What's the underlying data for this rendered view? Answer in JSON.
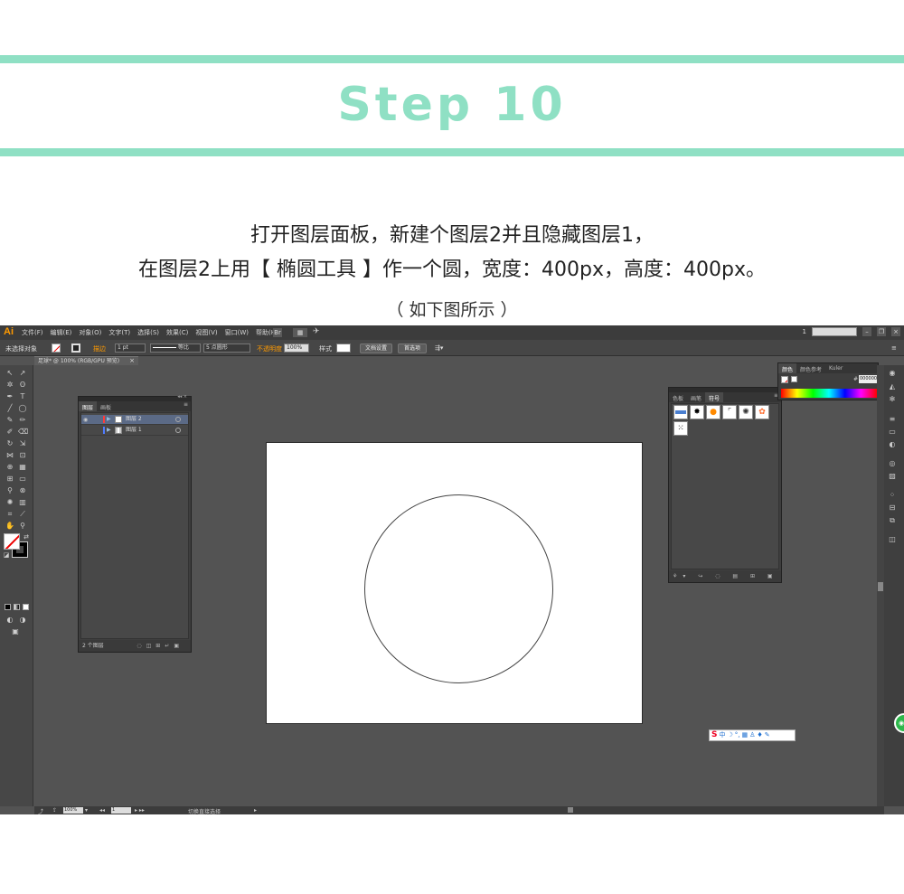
{
  "header": {
    "step_title": "Step 10",
    "line1": "打开图层面板，新建个图层2并且隐藏图层1，",
    "line2": "在图层2上用【 椭圆工具 】作一个圆，宽度：400px，高度：400px。",
    "line3": "（ 如下图所示 ）"
  },
  "app": {
    "logo": "Ai",
    "menu": [
      "文件(F)",
      "编辑(E)",
      "对象(O)",
      "文字(T)",
      "选择(S)",
      "效果(C)",
      "视图(V)",
      "窗口(W)",
      "帮助(H)"
    ],
    "workspace_number": "1"
  },
  "controlbar": {
    "no_selection": "未选择对象",
    "stroke_label": "描边",
    "stroke_weight": "1 pt",
    "uniform": "等比",
    "brush": "5 点圆形",
    "opacity_label": "不透明度",
    "opacity_value": "100%",
    "style_label": "样式",
    "doc_setup": "文档设置",
    "preferences": "首选项"
  },
  "document": {
    "tab_title": "足球* @ 100% (RGB/GPU 预览)",
    "tab_close": "×"
  },
  "layers_panel": {
    "tabs": [
      "图层",
      "画板"
    ],
    "layers": [
      {
        "name": "图层 2",
        "selected": true,
        "color": "#ff3b3b"
      },
      {
        "name": "图层 1",
        "selected": false,
        "color": "#4f7bff"
      }
    ],
    "footer": "2 个图层"
  },
  "symbols_panel": {
    "tabs": [
      "色板",
      "画笔",
      "符号"
    ]
  },
  "color_panel": {
    "tabs": [
      "颜色",
      "颜色参考",
      "Kuler"
    ],
    "hex_prefix": "#",
    "hex_value": "000000"
  },
  "statusbar": {
    "zoom": "100%",
    "page": "1",
    "tool": "切换直接选择"
  },
  "ime": {
    "logo": "S",
    "mode": "中"
  },
  "colors": {
    "accent": "#8fe0c4",
    "app_bg": "#535353",
    "panel_bg": "#3e3e3e"
  }
}
